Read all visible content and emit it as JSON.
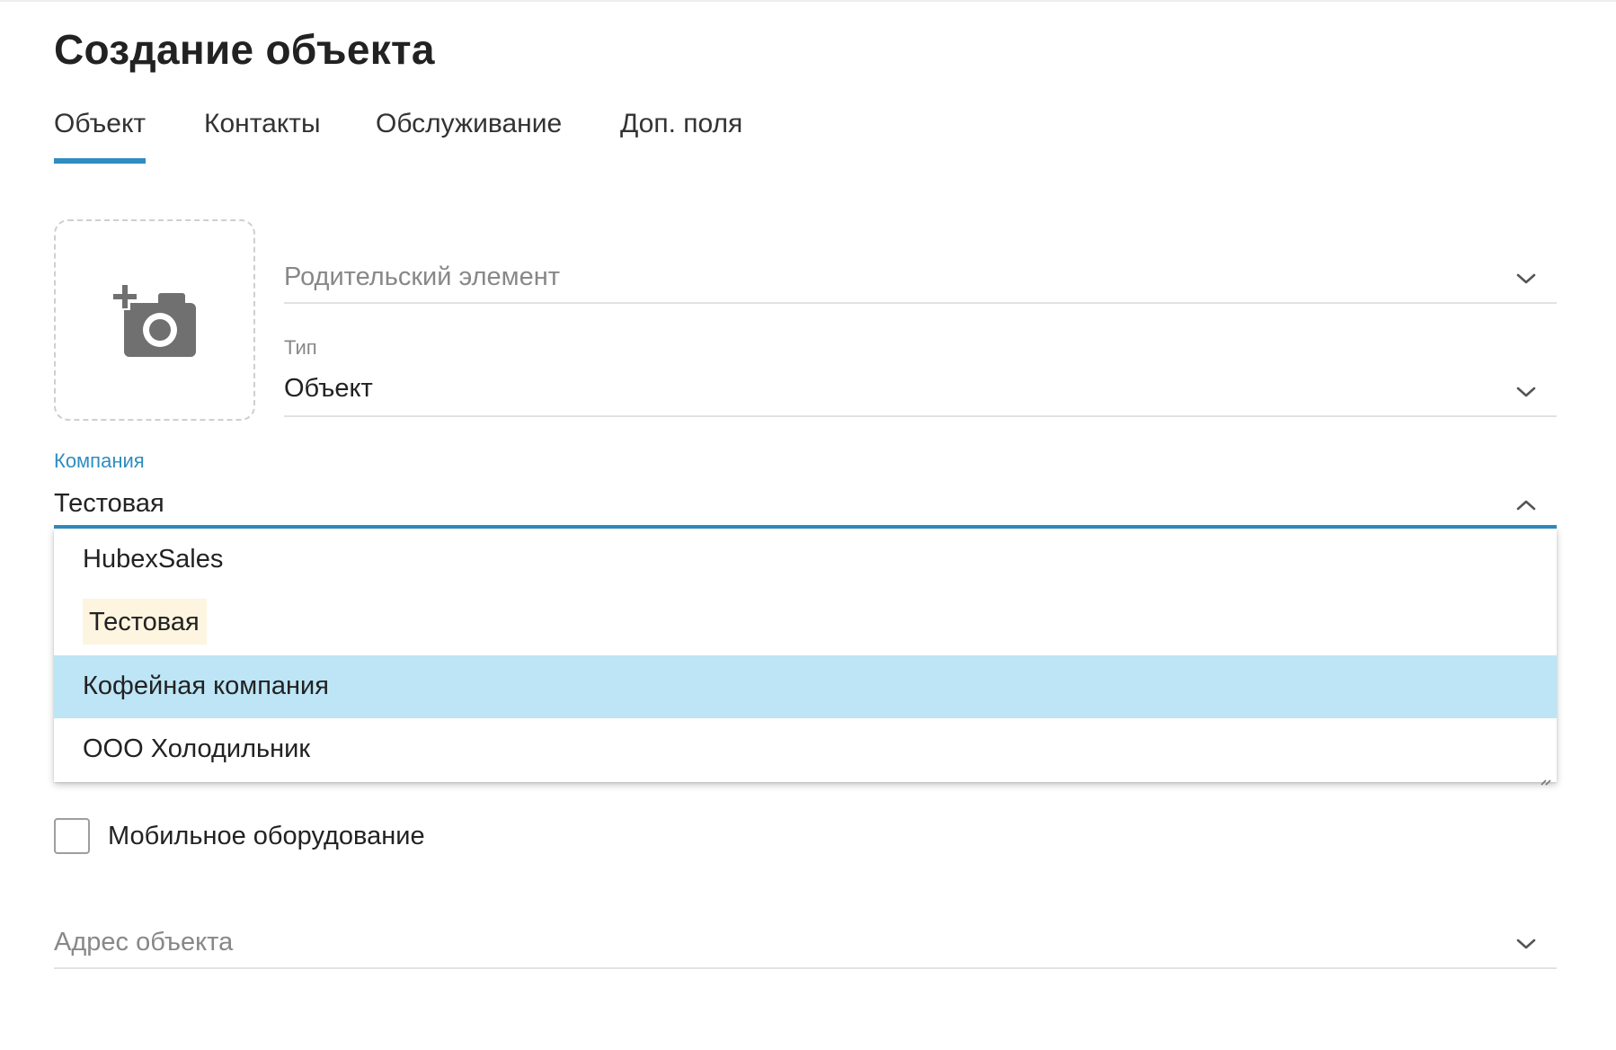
{
  "page": {
    "title": "Создание объекта"
  },
  "tabs": [
    {
      "label": "Объект",
      "active": true
    },
    {
      "label": "Контакты",
      "active": false
    },
    {
      "label": "Обслуживание",
      "active": false
    },
    {
      "label": "Доп. поля",
      "active": false
    }
  ],
  "photo": {
    "icon": "add-photo-icon"
  },
  "form": {
    "parent": {
      "placeholder": "Родительский элемент",
      "icon": "chevron-down-icon"
    },
    "type": {
      "label": "Тип",
      "value": "Объект",
      "icon": "chevron-down-icon"
    },
    "company": {
      "label": "Компания",
      "value": "Тестовая",
      "icon": "chevron-up-icon",
      "options": [
        "HubexSales",
        "Тестовая",
        "Кофейная компания",
        "ООО Холодильник"
      ],
      "selected": "Тестовая",
      "highlighted": "Кофейная компания"
    },
    "mobile_equipment": {
      "label": "Мобильное оборудование",
      "checked": false
    },
    "address": {
      "placeholder": "Адрес объекта",
      "icon": "chevron-down-icon"
    }
  },
  "colors": {
    "accent": "#2f8dc0",
    "hover": "#bde5f6",
    "selected": "#fdf5e0",
    "muted_text": "#888888",
    "icon_gray": "#707070"
  }
}
